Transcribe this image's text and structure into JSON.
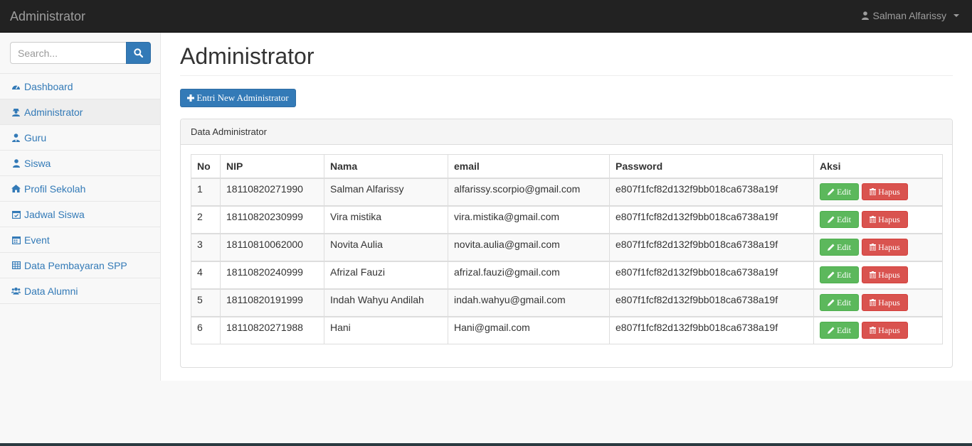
{
  "topbar": {
    "brand": "Administrator",
    "user_name": "Salman Alfarissy"
  },
  "sidebar": {
    "search_placeholder": "Search...",
    "items": [
      {
        "label": "Dashboard",
        "icon": "dashboard-icon"
      },
      {
        "label": "Administrator",
        "icon": "user-secret-icon",
        "active": true
      },
      {
        "label": "Guru",
        "icon": "user-tie-icon"
      },
      {
        "label": "Siswa",
        "icon": "user-icon"
      },
      {
        "label": "Profil Sekolah",
        "icon": "home-icon"
      },
      {
        "label": "Jadwal Siswa",
        "icon": "calendar-check-icon"
      },
      {
        "label": "Event",
        "icon": "calendar-icon"
      },
      {
        "label": "Data Pembayaran SPP",
        "icon": "table-icon"
      },
      {
        "label": "Data Alumni",
        "icon": "users-icon"
      }
    ]
  },
  "main": {
    "title": "Administrator",
    "new_button": "Entri New Administrator",
    "panel_title": "Data Administrator",
    "columns": [
      "No",
      "NIP",
      "Nama",
      "email",
      "Password",
      "Aksi"
    ],
    "edit_label": "Edit",
    "delete_label": "Hapus",
    "rows": [
      {
        "no": "1",
        "nip": "18110820271990",
        "nama": "Salman Alfarissy",
        "email": "alfarissy.scorpio@gmail.com",
        "password": "e807f1fcf82d132f9bb018ca6738a19f"
      },
      {
        "no": "2",
        "nip": "18110820230999",
        "nama": "Vira mistika",
        "email": "vira.mistika@gmail.com",
        "password": "e807f1fcf82d132f9bb018ca6738a19f"
      },
      {
        "no": "3",
        "nip": "18110810062000",
        "nama": "Novita Aulia",
        "email": "novita.aulia@gmail.com",
        "password": "e807f1fcf82d132f9bb018ca6738a19f"
      },
      {
        "no": "4",
        "nip": "18110820240999",
        "nama": "Afrizal Fauzi",
        "email": "afrizal.fauzi@gmail.com",
        "password": "e807f1fcf82d132f9bb018ca6738a19f"
      },
      {
        "no": "5",
        "nip": "18110820191999",
        "nama": "Indah Wahyu Andilah",
        "email": "indah.wahyu@gmail.com",
        "password": "e807f1fcf82d132f9bb018ca6738a19f"
      },
      {
        "no": "6",
        "nip": "18110820271988",
        "nama": "Hani",
        "email": "Hani@gmail.com",
        "password": "e807f1fcf82d132f9bb018ca6738a19f"
      }
    ]
  },
  "colors": {
    "primary": "#337ab7",
    "success": "#5cb85c",
    "danger": "#d9534f",
    "navbar": "#222222"
  }
}
